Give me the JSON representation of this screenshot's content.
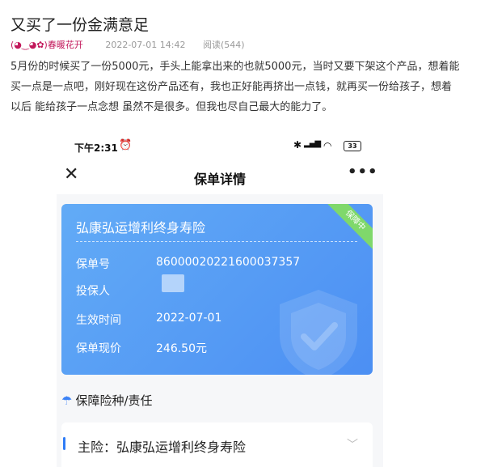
{
  "post": {
    "title": "又买了一份金满意足",
    "author": "(◕‿◕✿)春暖花开",
    "date": "2022-07-01 14:42",
    "views": "阅读(544)",
    "paragraphs": [
      "5月份的时候买了一份5000元，手头上能拿出来的也就5000元，当时又要下架这个产品，想着能",
      "买一点是一点吧，刚好现在这份产品还有，我也正好能再挤出一点钱，就再买一份给孩子，想着",
      "以后  能给孩子一点念想  虽然不是很多。但我也尽自己最大的能力了。"
    ]
  },
  "phone": {
    "status": {
      "time": "下午2:31",
      "battery": "33"
    },
    "nav": {
      "title": "保单详情",
      "more": "•••"
    },
    "card": {
      "product_name": "弘康弘运增利终身寿险",
      "status_ribbon": "保障中",
      "fields": [
        {
          "label": "保单号",
          "value": "86000020221600037357"
        },
        {
          "label": "投保人",
          "value": ""
        },
        {
          "label": "生效时间",
          "value": "2022-07-01"
        },
        {
          "label": "保单现价",
          "value": "246.50元"
        }
      ]
    },
    "coverage_section_title": "保障险种/责任",
    "main_policy_label": "主险：弘康弘运增利终身寿险"
  }
}
